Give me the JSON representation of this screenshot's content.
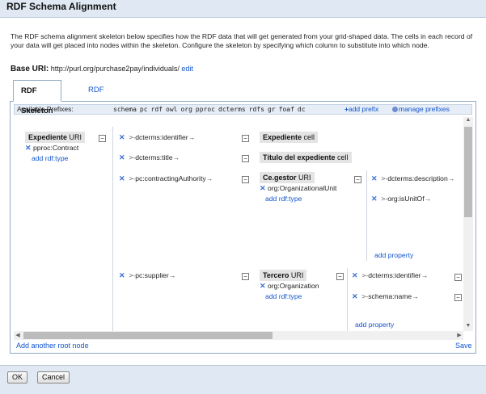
{
  "dialog": {
    "title": "RDF Schema Alignment",
    "description": "The RDF schema alignment skeleton below specifies how the RDF data that will get generated from your grid-shaped data. The cells in each record of your data will get placed into nodes within the skeleton. Configure the skeleton by specifying which column to substitute into which node.",
    "base_uri_label": "Base URI:",
    "base_uri_value": "http://purl.org/purchase2pay/individuals/",
    "base_uri_edit": "edit"
  },
  "tabs": [
    {
      "label": "RDF Skeleton",
      "active": true
    },
    {
      "label": "RDF Preview",
      "active": false
    }
  ],
  "prefixes": {
    "label": "Available Prefixes:",
    "items": [
      "schema",
      "pc",
      "rdf",
      "owl",
      "org",
      "pproc",
      "dcterms",
      "rdfs",
      "gr",
      "foaf",
      "dc"
    ],
    "add_label": "add prefix",
    "manage_label": "manage prefixes"
  },
  "skeleton": {
    "root": {
      "name": "Expediente",
      "kind": "URI",
      "type": "pproc:Contract",
      "add_type": "add rdf:type"
    },
    "links": [
      {
        "property": "dcterms:identifier",
        "target": "Expediente",
        "target_kind": "cell"
      },
      {
        "property": "dcterms:title",
        "target": "Título del expediente",
        "target_kind": "cell"
      },
      {
        "property": "pc:contractingAuthority",
        "target": "Ce.gestor",
        "target_kind": "URI",
        "target_type": "org:OrganizationalUnit",
        "add_type": "add rdf:type",
        "sub_properties": [
          "dcterms:description",
          "org:isUnitOf"
        ],
        "add_property": "add property"
      },
      {
        "property": "pc:supplier",
        "target": "Tercero",
        "target_kind": "URI",
        "target_type": "org:Organization",
        "add_type": "add rdf:type",
        "sub_properties": [
          "dcterms:identifier",
          "schema:name"
        ],
        "add_property": "add property"
      }
    ]
  },
  "panel_links": {
    "add_root": "Add another root node",
    "save": "Save"
  },
  "buttons": {
    "ok": "OK",
    "cancel": "Cancel"
  },
  "glyphs": {
    "remove": "✕",
    "collapse": "−",
    "arrow": "→",
    "add_plus": "+"
  },
  "colors": {
    "link": "#1155cc",
    "title_bar": "#dfe8f3",
    "node_bg": "#e4e4e4"
  }
}
